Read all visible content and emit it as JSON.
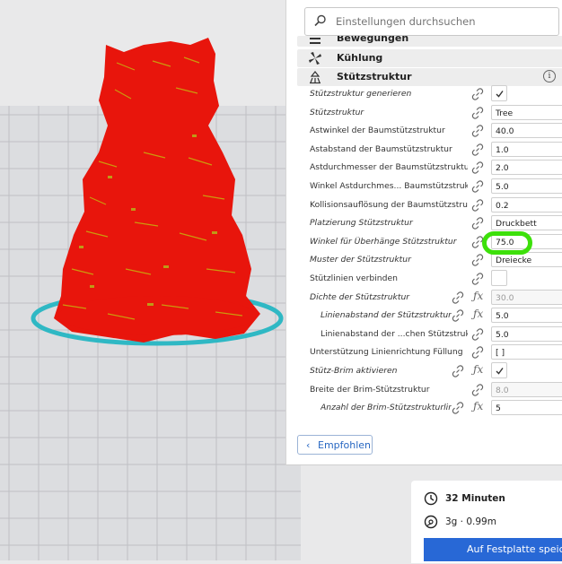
{
  "search": {
    "placeholder": "Einstellungen durchsuchen"
  },
  "categories": [
    {
      "label": "Bewegungen",
      "icon": "movement-icon"
    },
    {
      "label": "Kühlung",
      "icon": "fan-icon"
    },
    {
      "label": "Stützstruktur",
      "icon": "support-icon",
      "info": "i"
    }
  ],
  "settings": [
    {
      "label": "Stützstruktur generieren",
      "italic": true,
      "value": "",
      "type": "checkbox",
      "checked": true
    },
    {
      "label": "Stützstruktur",
      "italic": true,
      "value": "Tree",
      "type": "select"
    },
    {
      "label": "Astwinkel der Baumstützstruktur",
      "italic": false,
      "value": "40.0",
      "type": "text"
    },
    {
      "label": "Astabstand der Baumstützstruktur",
      "italic": false,
      "value": "1.0",
      "type": "text"
    },
    {
      "label": "Astdurchmesser der Baumstützstruktur",
      "italic": false,
      "value": "2.0",
      "type": "text"
    },
    {
      "label": "Winkel Astdurchmes... Baumstützstruktur",
      "italic": false,
      "value": "5.0",
      "type": "text"
    },
    {
      "label": "Kollisionsauflösung der Baumstützstruktur",
      "italic": false,
      "value": "0.2",
      "type": "text"
    },
    {
      "label": "Platzierung Stützstruktur",
      "italic": true,
      "value": "Druckbett berühr...",
      "type": "select"
    },
    {
      "label": "Winkel für Überhänge Stützstruktur",
      "italic": true,
      "value": "75.0",
      "type": "text"
    },
    {
      "label": "Muster der Stützstruktur",
      "italic": true,
      "value": "Dreiecke",
      "type": "select"
    },
    {
      "label": "Stützlinien verbinden",
      "italic": false,
      "value": "",
      "type": "checkbox",
      "checked": false
    },
    {
      "label": "Dichte der Stützstruktur",
      "italic": true,
      "value": "30.0",
      "type": "text",
      "disabled": true,
      "fx": true
    },
    {
      "label": "Linienabstand der Stützstruktur",
      "italic": true,
      "value": "5.0",
      "type": "text",
      "indent": true,
      "fx": true
    },
    {
      "label": "Linienabstand der ...chen Stützstruktur",
      "italic": false,
      "value": "5.0",
      "type": "text",
      "indent": true
    },
    {
      "label": "Unterstützung Linienrichtung Füllung",
      "italic": false,
      "value": "[ ]",
      "type": "text"
    },
    {
      "label": "Stütz-Brim aktivieren",
      "italic": true,
      "value": "",
      "type": "checkbox",
      "checked": true,
      "fx": true
    },
    {
      "label": "Breite der Brim-Stützstruktur",
      "italic": false,
      "value": "8.0",
      "type": "text",
      "disabled": true
    },
    {
      "label": "Anzahl der Brim-Stützstrukturlinien",
      "italic": true,
      "value": "5",
      "type": "text",
      "indent": true,
      "fx": true
    }
  ],
  "recommended_button": {
    "label": "Empfohlen"
  },
  "status": {
    "time": "32 Minuten",
    "material": "3g · 0.99m",
    "save_label": "Auf Festplatte speichern"
  },
  "colors": {
    "model_red": "#e8150c",
    "brim_cyan": "#2fb8c4",
    "highlight_green": "#3de00b",
    "accent_blue": "#2868d6"
  }
}
